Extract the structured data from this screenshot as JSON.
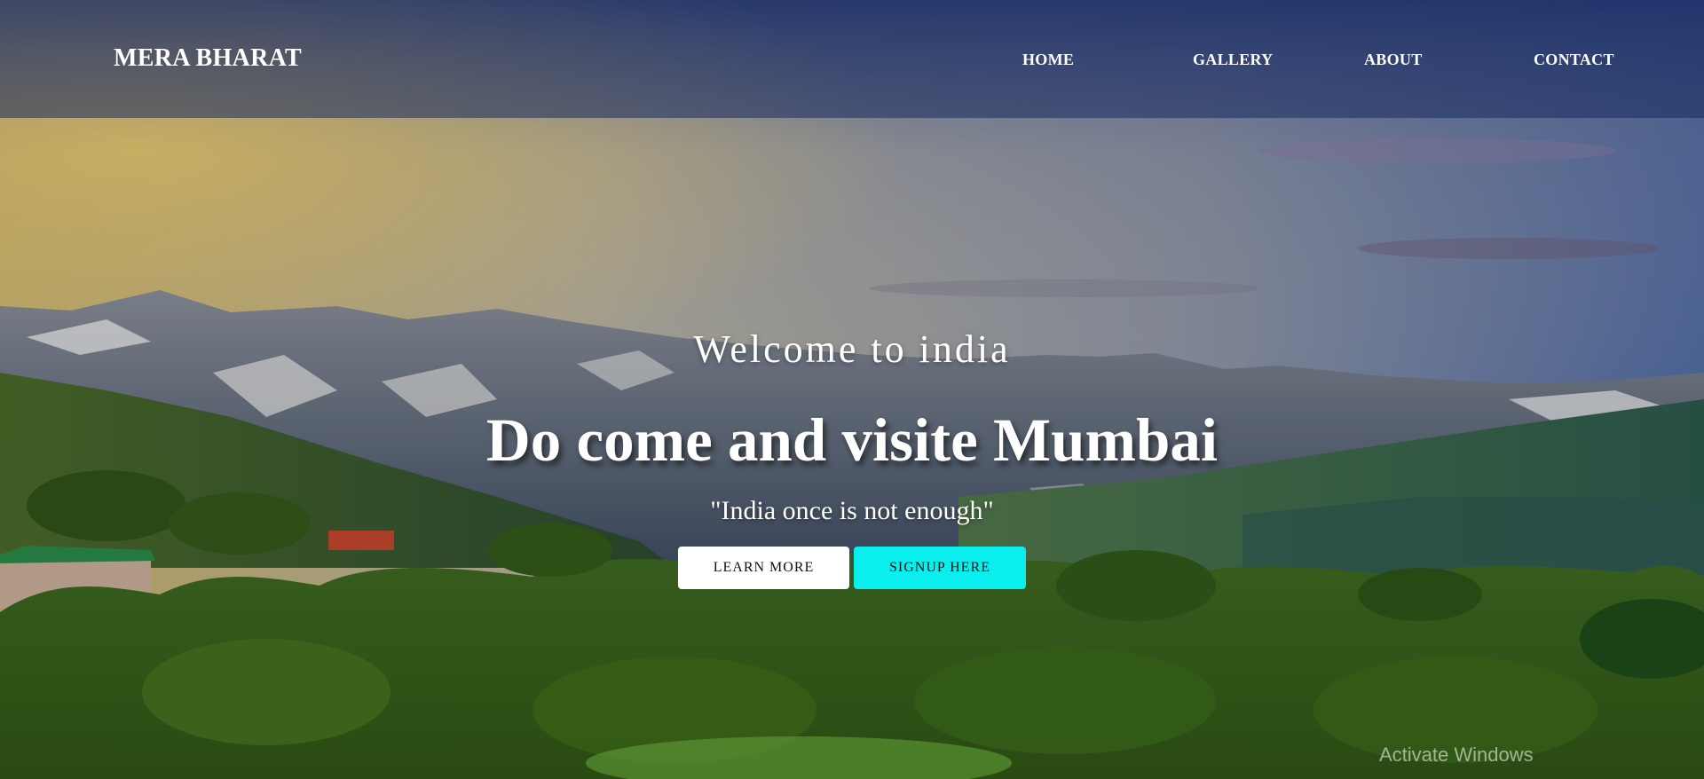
{
  "header": {
    "brand": "MERA BHARAT",
    "nav": [
      {
        "label": "HOME"
      },
      {
        "label": "GALLERY"
      },
      {
        "label": "ABOUT"
      },
      {
        "label": "CONTACT"
      }
    ]
  },
  "hero": {
    "welcome": "Welcome to india",
    "title": "Do come and visite Mumbai",
    "tagline": "\"India once is not enough\"",
    "buttons": {
      "learn_more": "LEARN MORE",
      "signup": "SIGNUP HERE"
    }
  },
  "overlay": {
    "watermark": "Activate Windows"
  },
  "colors": {
    "header_bg": "#1a2c60",
    "primary_button_bg": "#ffffff",
    "accent_button_bg": "#0aeeee",
    "text": "#ffffff"
  }
}
